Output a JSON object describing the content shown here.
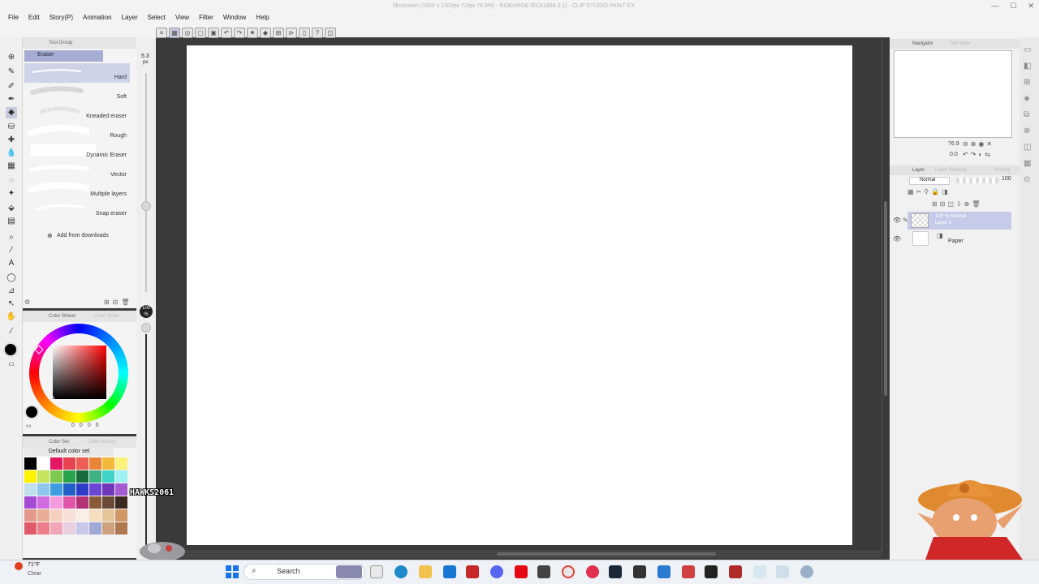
{
  "window": {
    "title": "Illustration (1600 x 1200px 72dpi 76.9%) - RGB/sRGB IEC61966-2.1) - CLIP STUDIO PAINT EX"
  },
  "menu": [
    "File",
    "Edit",
    "Story(P)",
    "Animation",
    "Layer",
    "Select",
    "View",
    "Filter",
    "Window",
    "Help"
  ],
  "subtool": {
    "tab_label": "Tool Group",
    "group_label": "Eraser",
    "brushes": [
      "Hard",
      "Soft",
      "Kneaded eraser",
      "Rough",
      "Dynamic Eraser",
      "Vector",
      "Multiple layers",
      "Snap eraser"
    ],
    "add_label": "Add from downloads",
    "size_value": "5.3",
    "size_unit": "px"
  },
  "opacity": {
    "value": "100",
    "unit": "%"
  },
  "colorwheel": {
    "tab_label": "Color Wheel",
    "tab2_label": "Color Slider",
    "values": [
      "0",
      "0",
      "0",
      "0"
    ],
    "main_color": "#000000"
  },
  "colorset": {
    "tab_label": "Color Set",
    "tab2_label": "Color History",
    "set_name": "Default color set",
    "swatches": [
      "#000000",
      "#ffffff",
      "#e51764",
      "#e8424f",
      "#eb5f56",
      "#e88538",
      "#f2b93d",
      "#fff27a",
      "#fff200",
      "#c5e35c",
      "#7dc84f",
      "#2aa44a",
      "#166c3a",
      "#3eb185",
      "#3fd3c8",
      "#9ff1f2",
      "#c0e0ee",
      "#8fc6ec",
      "#3e9ee0",
      "#2260c8",
      "#2b3cc8",
      "#6b46d6",
      "#7038b8",
      "#a45bd1",
      "#a64bd4",
      "#d16be0",
      "#f59adc",
      "#e055a8",
      "#b53277",
      "#8a5a3a",
      "#6b4a36",
      "#3b2a20",
      "#e39a8c",
      "#e8ad94",
      "#f6cfc1",
      "#f7e0d8",
      "#fbeee6",
      "#f5dfc0",
      "#e6c49a",
      "#d09664",
      "#e15a6a",
      "#eb7e8a",
      "#f0a8b8",
      "#e8d0e0",
      "#c8c8e8",
      "#a0a8d8",
      "#cda080",
      "#b07850"
    ]
  },
  "navigator": {
    "tab_label": "Navigator",
    "tab2_label": "Sub View",
    "zoom": "76.9",
    "angle": "0.0"
  },
  "layer": {
    "tab_label": "Layer",
    "tab2_label": "Layer Property",
    "tab3_label": "History",
    "blend_mode": "Normal",
    "opacity": "100",
    "layers": [
      {
        "mode": "100 % Normal",
        "name": "Layer 1"
      },
      {
        "mode": "",
        "name": "Paper"
      }
    ]
  },
  "overlay_tag": "HAWKS2061",
  "taskbar": {
    "weather_temp": "71°F",
    "weather_desc": "Clear",
    "search_label": "Search"
  }
}
